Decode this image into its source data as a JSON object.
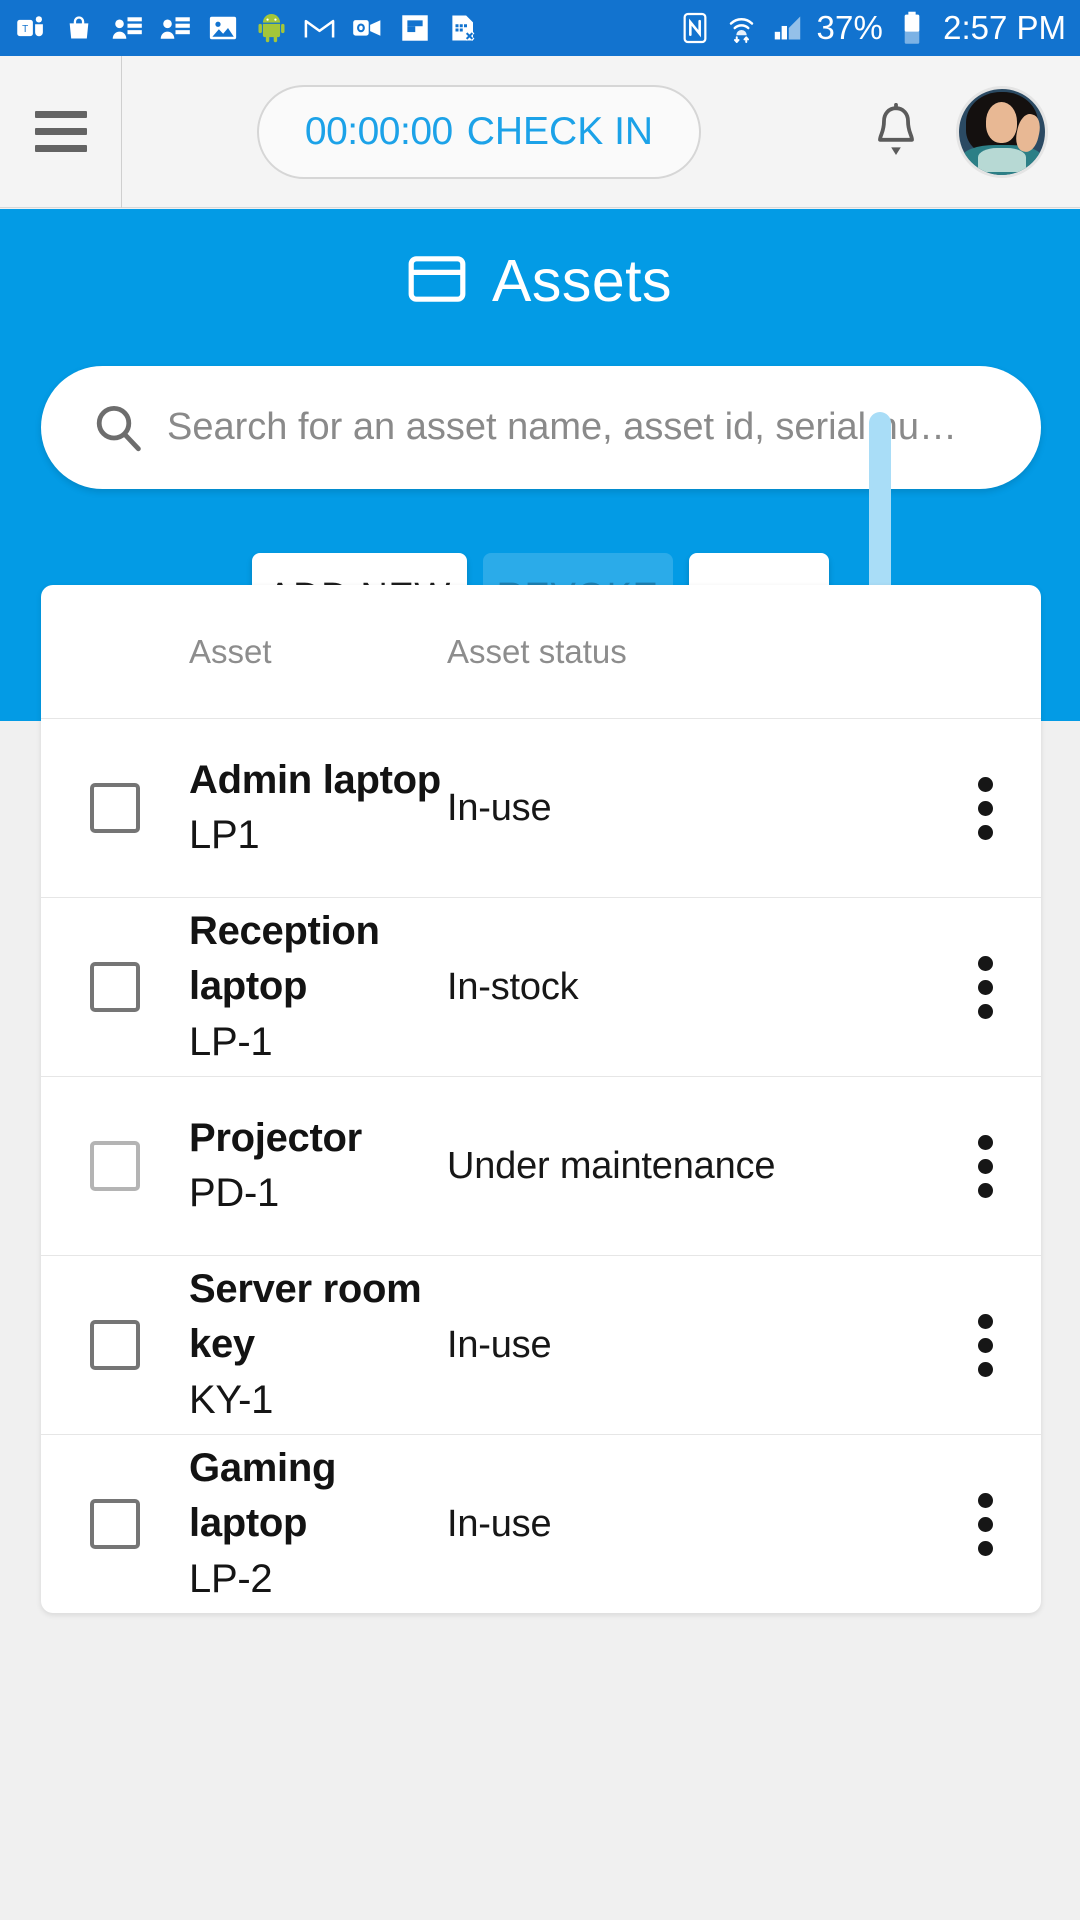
{
  "statusbar": {
    "left_icons": [
      {
        "name": "ms-teams-icon"
      },
      {
        "name": "shopping-bag-icon"
      },
      {
        "name": "contact-card-icon"
      },
      {
        "name": "contact-card-icon"
      },
      {
        "name": "photos-icon"
      },
      {
        "name": "android-icon"
      },
      {
        "name": "gmail-icon"
      },
      {
        "name": "outlook-video-icon"
      },
      {
        "name": "flipboard-icon"
      },
      {
        "name": "sim-card-error-icon"
      }
    ],
    "nfc_icon": "nfc-icon",
    "wifi_icon": "wifi-icon",
    "signal_icon": "cellular-signal-icon",
    "battery_percent": "37%",
    "battery_icon": "battery-icon",
    "time": "2:57 PM"
  },
  "appbar": {
    "menu_icon": "hamburger-menu-icon",
    "checkin": {
      "timer": "00:00:00",
      "label": "CHECK IN"
    },
    "bell_icon": "notification-bell-icon",
    "avatar_icon": "user-avatar"
  },
  "page": {
    "title": "Assets",
    "title_icon": "window-icon",
    "accent_color": "#039be5"
  },
  "search": {
    "icon": "search-icon",
    "placeholder": "Search for an asset name, asset id, serial nu…",
    "value": ""
  },
  "actions": {
    "add_new": "ADD NEW",
    "revoke": "REVOKE",
    "more_icon": "overflow-horizontal-icon"
  },
  "table": {
    "headers": {
      "asset": "Asset",
      "status": "Asset status"
    },
    "rows": [
      {
        "name": "Admin laptop",
        "id": "LP1",
        "status": "In-use",
        "checked": false,
        "checkbox_style": "dark"
      },
      {
        "name": "Reception laptop",
        "id": "LP-1",
        "status": "In-stock",
        "checked": false,
        "checkbox_style": "dark"
      },
      {
        "name": "Projector",
        "id": "PD-1",
        "status": "Under maintenance",
        "checked": false,
        "checkbox_style": "light"
      },
      {
        "name": "Server room key",
        "id": "KY-1",
        "status": "In-use",
        "checked": false,
        "checkbox_style": "dark"
      },
      {
        "name": "Gaming laptop",
        "id": "LP-2",
        "status": "In-use",
        "checked": false,
        "checkbox_style": "dark"
      }
    ],
    "row_menu_icon": "overflow-vertical-icon",
    "row_checkbox": "row-select-checkbox"
  }
}
